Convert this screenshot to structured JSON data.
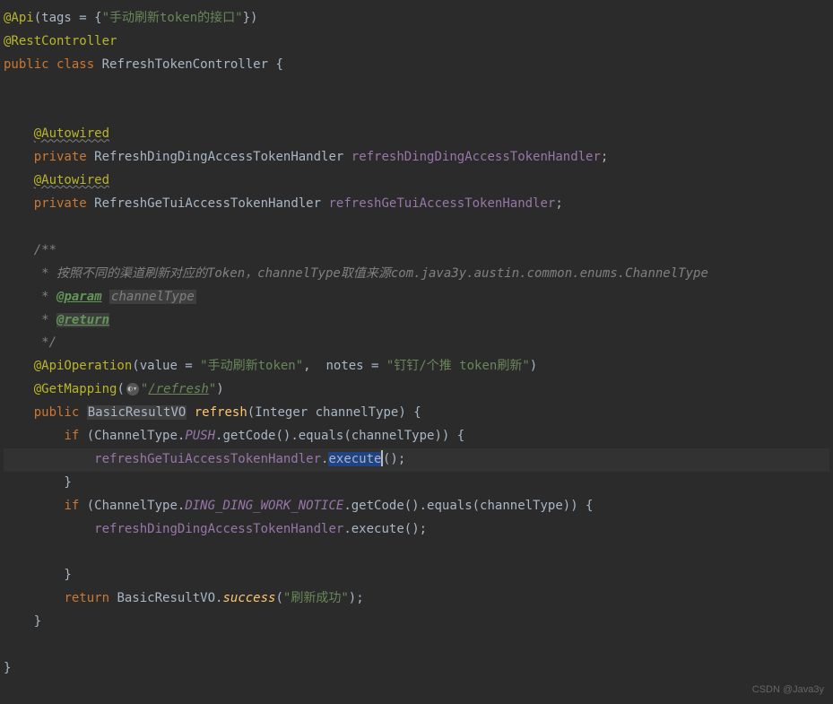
{
  "code": {
    "apiTag": "\"手动刷新token的接口\"",
    "restController": "@RestController",
    "classDecl": {
      "mod": "public class",
      "name": "RefreshTokenController"
    },
    "autowired": "@Autowired",
    "field1": {
      "mod": "private",
      "type": "RefreshDingDingAccessTokenHandler",
      "name": "refreshDingDingAccessTokenHandler"
    },
    "field2": {
      "mod": "private",
      "type": "RefreshGeTuiAccessTokenHandler",
      "name": "refreshGeTuiAccessTokenHandler"
    },
    "javadoc": {
      "open": "/**",
      "line1": " * 按照不同的渠道刷新对应的Token，channelType取值来源com.java3y.austin.common.enums.ChannelType",
      "paramTag": "@param",
      "paramName": "channelType",
      "returnTag": "@return",
      "close": " */"
    },
    "apiOp": {
      "value": "\"手动刷新token\"",
      "notes": "\"钉钉/个推 token刷新\""
    },
    "getMapping": {
      "path": "/refresh"
    },
    "methodDecl": {
      "mod": "public",
      "ret": "BasicResultVO",
      "name": "refresh",
      "params": "Integer channelType"
    },
    "if1Enum": "PUSH",
    "if2Enum": "DING_DING_WORK_NOTICE",
    "handler1": "refreshGeTuiAccessTokenHandler",
    "handler2": "refreshDingDingAccessTokenHandler",
    "execute": "execute",
    "returnStmt": {
      "cls": "BasicResultVO",
      "method": "success",
      "arg": "\"刷新成功\""
    }
  },
  "watermark": "CSDN @Java3y"
}
